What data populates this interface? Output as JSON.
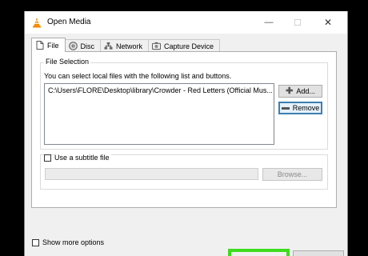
{
  "window": {
    "title": "Open Media",
    "icon": "vlc-cone-icon",
    "controls": {
      "minimize": "—",
      "maximize": "☐",
      "close": "✕"
    }
  },
  "tabs": [
    {
      "label": "File",
      "icon": "file-icon",
      "active": true
    },
    {
      "label": "Disc",
      "icon": "disc-icon",
      "active": false
    },
    {
      "label": "Network",
      "icon": "network-icon",
      "active": false
    },
    {
      "label": "Capture Device",
      "icon": "capture-device-icon",
      "active": false
    }
  ],
  "file_selection": {
    "group_label": "File Selection",
    "hint": "You can select local files with the following list and buttons.",
    "files": [
      "C:\\Users\\FLORE\\Desktop\\library\\Crowder - Red Letters (Official Mus..."
    ],
    "add_label": "Add...",
    "remove_label": "Remove"
  },
  "subtitle": {
    "checkbox_label": "Use a subtitle file",
    "checked": false,
    "browse_label": "Browse..."
  },
  "show_more": {
    "label": "Show more options",
    "checked": false
  },
  "colors": {
    "highlight": "#3ddc1e",
    "focus_border": "#3c7fb1",
    "vlc_orange": "#f48b00"
  }
}
